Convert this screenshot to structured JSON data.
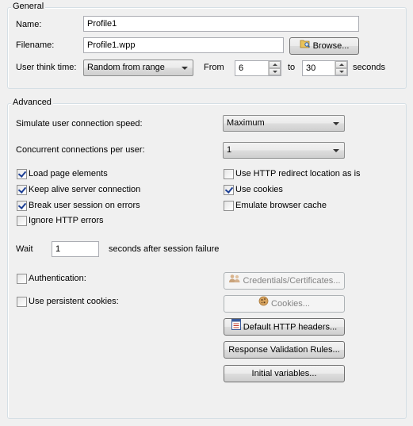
{
  "general": {
    "legend": "General",
    "name_label": "Name:",
    "name_value": "Profile1",
    "filename_label": "Filename:",
    "filename_value": "Profile1.wpp",
    "browse_label": "Browse...",
    "think_time_label": "User think time:",
    "think_time_mode": "Random from range",
    "from_label": "From",
    "from_value": "6",
    "to_label": "to",
    "to_value": "30",
    "seconds_label": "seconds"
  },
  "advanced": {
    "legend": "Advanced",
    "conn_speed_label": "Simulate user connection speed:",
    "conn_speed_value": "Maximum",
    "concurrent_label": "Concurrent connections per user:",
    "concurrent_value": "1",
    "checkboxes_left": [
      {
        "label": "Load page elements",
        "checked": true
      },
      {
        "label": "Keep alive server connection",
        "checked": true
      },
      {
        "label": "Break user session on errors",
        "checked": true
      },
      {
        "label": "Ignore HTTP errors",
        "checked": false
      }
    ],
    "checkboxes_right": [
      {
        "label": "Use HTTP redirect location as is",
        "checked": false
      },
      {
        "label": "Use cookies",
        "checked": true
      },
      {
        "label": "Emulate browser cache",
        "checked": false
      }
    ],
    "wait_label": "Wait",
    "wait_value": "1",
    "wait_suffix": "seconds after session failure",
    "authentication_label": "Authentication:",
    "authentication_checked": false,
    "persistent_cookies_label": "Use persistent cookies:",
    "persistent_cookies_checked": false,
    "credentials_button": "Credentials/Certificates...",
    "cookies_button": "Cookies...",
    "headers_button": "Default HTTP headers...",
    "validation_button": "Response Validation Rules...",
    "variables_button": "Initial variables..."
  },
  "icons": {
    "browse": "folder-search-icon",
    "credentials": "users-icon",
    "cookies": "cookie-icon",
    "headers": "document-list-icon"
  }
}
